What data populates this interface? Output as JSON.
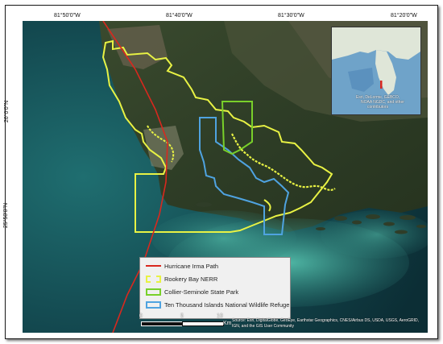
{
  "map": {
    "coordinates": {
      "top": [
        "81°50'0\"W",
        "81°40'0\"W",
        "81°30'0\"W",
        "81°20'0\"W"
      ],
      "left": [
        "26°0'0\"N",
        "25°50'0\"N"
      ]
    },
    "inset_credit": [
      "Esri, DeLorme, GEBCO,",
      "NOAA NGDC, and other",
      "contributors"
    ],
    "legend": [
      {
        "label": "Hurricane Irma Path",
        "color": "#d9281e",
        "style": "line"
      },
      {
        "label": "Rookery Bay NERR",
        "color": "#e8f244",
        "style": "box"
      },
      {
        "label": "Collier-Seminole State Park",
        "color": "#79d02a",
        "style": "box"
      },
      {
        "label": "Ten Thousand Islands National Wildlife Refuge",
        "color": "#4fa3e0",
        "style": "box"
      }
    ],
    "scale": {
      "ticks": [
        "0",
        "5",
        "10"
      ],
      "unit": "Km"
    },
    "credits": "Source: Esri, DigitalGlobe, GeoEye, Earthstar Geographics, CNES/Airbus DS, USDA, USGS, AeroGRID, IGN, and the GIS User Community"
  }
}
